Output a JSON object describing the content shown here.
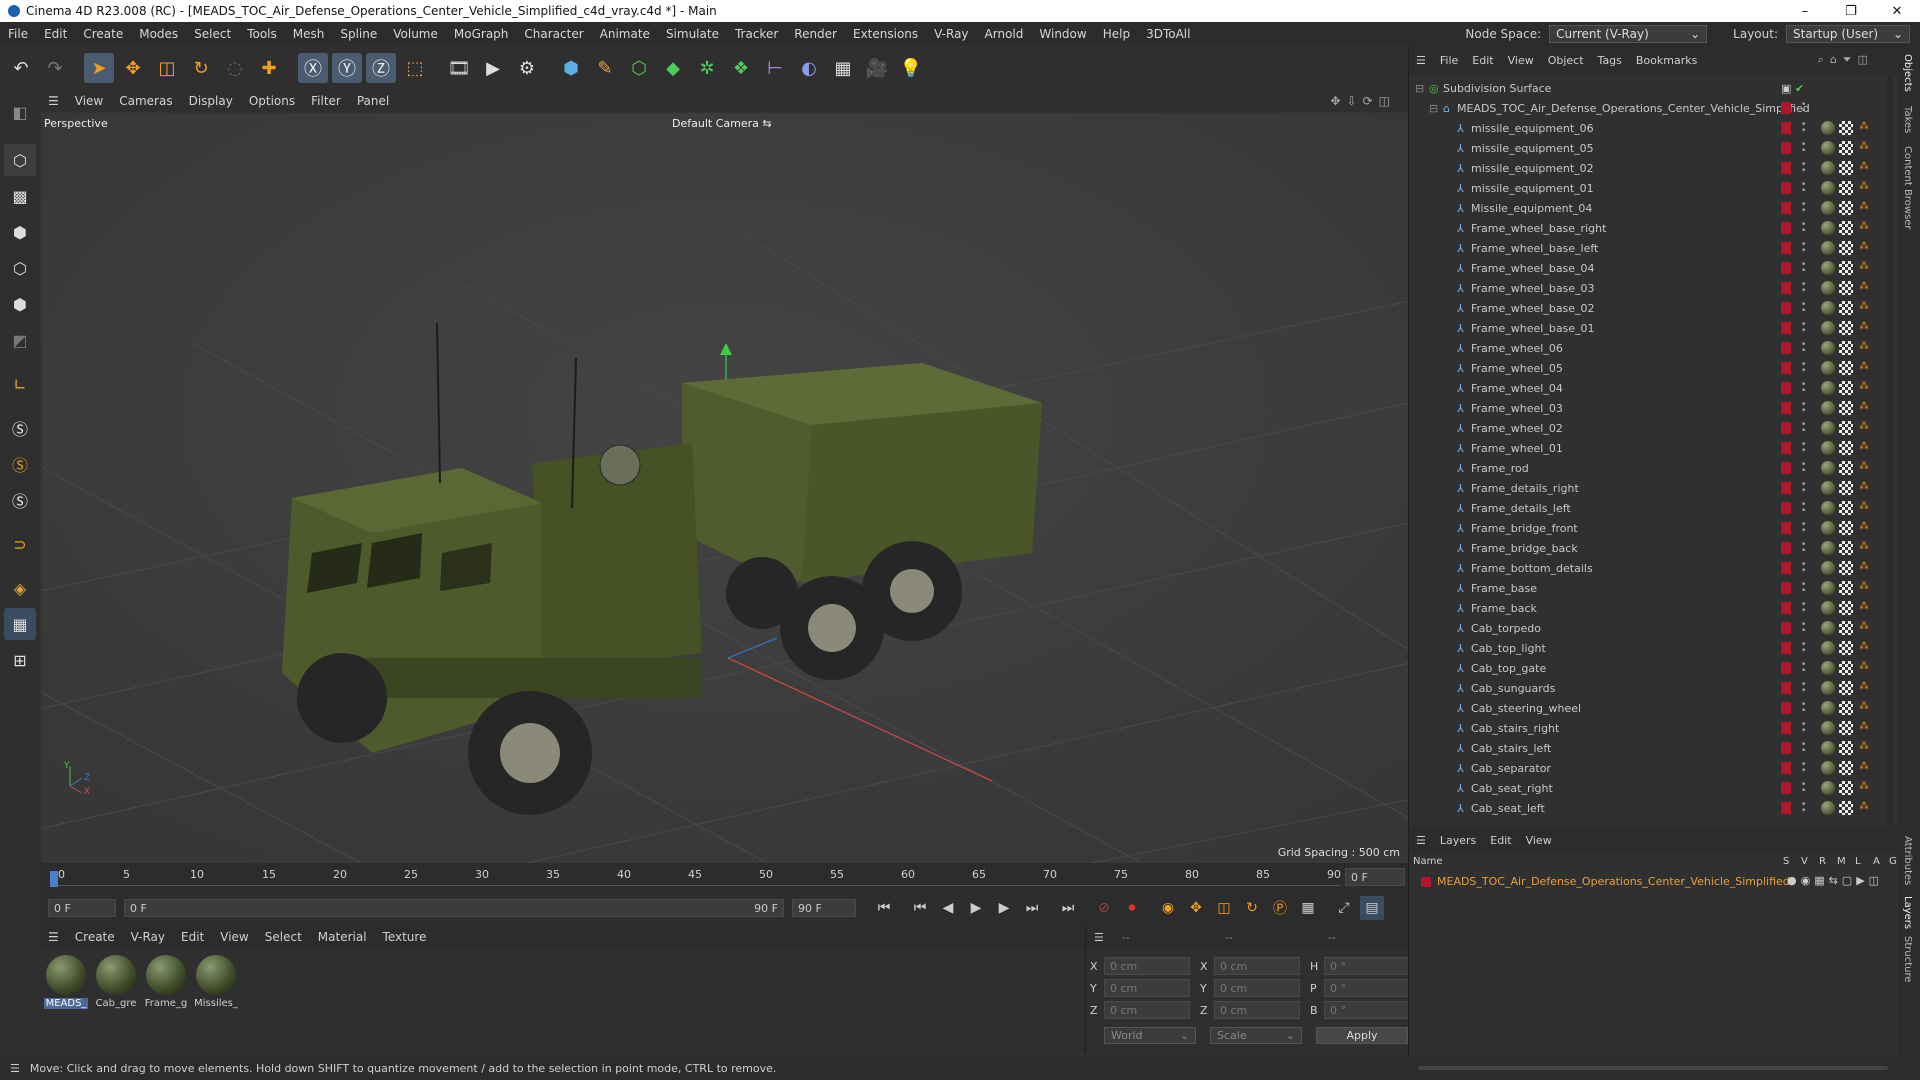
{
  "window": {
    "title": "Cinema 4D R23.008 (RC) - [MEADS_TOC_Air_Defense_Operations_Center_Vehicle_Simplified_c4d_vray.c4d *] - Main",
    "controls": [
      "–",
      "❐",
      "✕"
    ]
  },
  "menubar": {
    "items": [
      "File",
      "Edit",
      "Create",
      "Modes",
      "Select",
      "Tools",
      "Mesh",
      "Spline",
      "Volume",
      "MoGraph",
      "Character",
      "Animate",
      "Simulate",
      "Tracker",
      "Render",
      "Extensions",
      "V-Ray",
      "Arnold",
      "Window",
      "Help",
      "3DToAll"
    ],
    "node_space_label": "Node Space:",
    "node_space_value": "Current (V-Ray)",
    "layout_label": "Layout:",
    "layout_value": "Startup (User)"
  },
  "viewport": {
    "menu": [
      "View",
      "Cameras",
      "Display",
      "Options",
      "Filter",
      "Panel"
    ],
    "view_name": "Perspective",
    "camera": "Default Camera",
    "grid_spacing": "Grid Spacing : 500 cm",
    "axis_labels": {
      "y": "Y",
      "z": "Z",
      "x": "X"
    }
  },
  "timeline": {
    "ticks": [
      "0",
      "5",
      "10",
      "15",
      "20",
      "25",
      "30",
      "35",
      "40",
      "45",
      "50",
      "55",
      "60",
      "65",
      "70",
      "75",
      "80",
      "85",
      "90"
    ],
    "current_frame_right": "0 F"
  },
  "playback": {
    "start": "0 F",
    "range_start": "0 F",
    "range_end": "90 F",
    "end": "90 F"
  },
  "materials": {
    "menu": [
      "Create",
      "V-Ray",
      "Edit",
      "View",
      "Select",
      "Material",
      "Texture"
    ],
    "items": [
      {
        "label": "MEADS_",
        "selected": true
      },
      {
        "label": "Cab_gre",
        "selected": false
      },
      {
        "label": "Frame_g",
        "selected": false
      },
      {
        "label": "Missiles_",
        "selected": false
      }
    ]
  },
  "coordinates": {
    "headers": [
      "--",
      "--",
      "--"
    ],
    "rows": [
      {
        "axis": "X",
        "pos": "0 cm",
        "axis2": "X",
        "size": "0 cm",
        "rot_label": "H",
        "rot": "0 °"
      },
      {
        "axis": "Y",
        "pos": "0 cm",
        "axis2": "Y",
        "size": "0 cm",
        "rot_label": "P",
        "rot": "0 °"
      },
      {
        "axis": "Z",
        "pos": "0 cm",
        "axis2": "Z",
        "size": "0 cm",
        "rot_label": "B",
        "rot": "0 °"
      }
    ],
    "mode": "World",
    "transform": "Scale",
    "apply": "Apply"
  },
  "objects": {
    "menu": [
      "File",
      "Edit",
      "View",
      "Object",
      "Tags",
      "Bookmarks"
    ],
    "root": "Subdivision Surface",
    "group": "MEADS_TOC_Air_Defense_Operations_Center_Vehicle_Simplified",
    "children": [
      "missile_equipment_06",
      "missile_equipment_05",
      "missile_equipment_02",
      "missile_equipment_01",
      "Missile_equipment_04",
      "Frame_wheel_base_right",
      "Frame_wheel_base_left",
      "Frame_wheel_base_04",
      "Frame_wheel_base_03",
      "Frame_wheel_base_02",
      "Frame_wheel_base_01",
      "Frame_wheel_06",
      "Frame_wheel_05",
      "Frame_wheel_04",
      "Frame_wheel_03",
      "Frame_wheel_02",
      "Frame_wheel_01",
      "Frame_rod",
      "Frame_details_right",
      "Frame_details_left",
      "Frame_bridge_front",
      "Frame_bridge_back",
      "Frame_bottom_details",
      "Frame_base",
      "Frame_back",
      "Cab_torpedo",
      "Cab_top_light",
      "Cab_top_gate",
      "Cab_sunguards",
      "Cab_steering_wheel",
      "Cab_stairs_right",
      "Cab_stairs_left",
      "Cab_separator",
      "Cab_seat_right",
      "Cab_seat_left"
    ]
  },
  "layers": {
    "menu": [
      "Layers",
      "Edit",
      "View"
    ],
    "col_name": "Name",
    "cols": [
      "S",
      "V",
      "R",
      "M",
      "L",
      "A",
      "G"
    ],
    "items": [
      "MEADS_TOC_Air_Defense_Operations_Center_Vehicle_Simplified"
    ]
  },
  "side_tabs": [
    "Objects",
    "Takes",
    "Content Browser",
    "Attributes",
    "Layers",
    "Structure"
  ],
  "status": "Move: Click and drag to move elements. Hold down SHIFT to quantize movement / add to the selection in point mode, CTRL to remove.",
  "colors": {
    "accent": "#4b5c70",
    "tag_red": "#b0162e",
    "layer_orange": "#e8a13a",
    "truck_green": "#4f5a2a"
  }
}
